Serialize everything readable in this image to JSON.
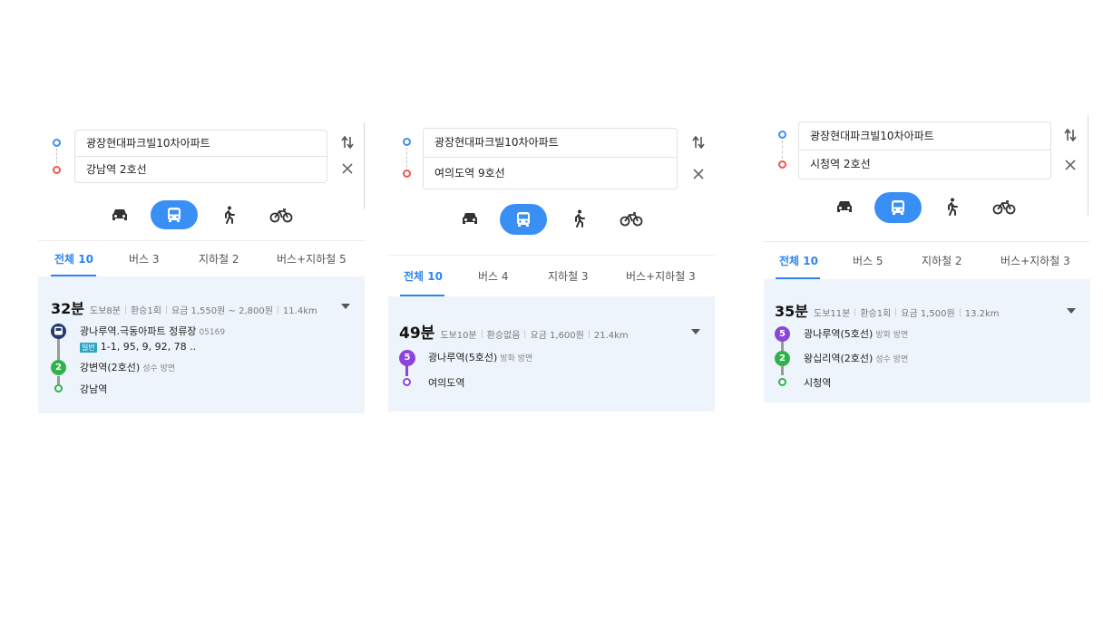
{
  "panels": [
    {
      "origin": "광장현대파크빌10차아파트",
      "destination": "강남역 2호선",
      "tabs": [
        {
          "label": "전체 10",
          "active": true
        },
        {
          "label": "버스 3"
        },
        {
          "label": "지하철 2"
        },
        {
          "label": "버스+지하철 5"
        }
      ],
      "result": {
        "time": "32분",
        "walk": "도보8분",
        "transfer": "환승1회",
        "fare": "요금 1,550원 ~ 2,800원",
        "distance": "11.4km",
        "steps": [
          {
            "badge": "",
            "badge_type": "bus",
            "name": "광나루역.극동아파트 정류장",
            "sub": "05169",
            "bus_tag": "일반",
            "bus_numbers": "1-1, 95, 9, 92, 78 ..",
            "color": "#263a6e"
          },
          {
            "badge": "2",
            "name": "강변역(2호선)",
            "sub": "성수 방면",
            "color": "#2fb24a"
          },
          {
            "badge": "",
            "badge_type": "end",
            "name": "강남역",
            "color": "#2fb24a"
          }
        ]
      }
    },
    {
      "origin": "광장현대파크빌10차아파트",
      "destination": "여의도역 9호선",
      "tabs": [
        {
          "label": "전체 10",
          "active": true
        },
        {
          "label": "버스 4"
        },
        {
          "label": "지하철 3"
        },
        {
          "label": "버스+지하철 3"
        }
      ],
      "result": {
        "time": "49분",
        "walk": "도보10분",
        "transfer": "환승없음",
        "fare": "요금 1,600원",
        "distance": "21.4km",
        "steps": [
          {
            "badge": "5",
            "name": "광나루역(5호선)",
            "sub": "방화 방면",
            "color": "#8c45d8"
          },
          {
            "badge": "",
            "badge_type": "end",
            "name": "여의도역",
            "color": "#8c45d8"
          }
        ]
      }
    },
    {
      "origin": "광장현대파크빌10차아파트",
      "destination": "시청역 2호선",
      "tabs": [
        {
          "label": "전체 10",
          "active": true
        },
        {
          "label": "버스 5"
        },
        {
          "label": "지하철 2"
        },
        {
          "label": "버스+지하철 3"
        }
      ],
      "result": {
        "time": "35분",
        "walk": "도보11분",
        "transfer": "환승1회",
        "fare": "요금 1,500원",
        "distance": "13.2km",
        "steps": [
          {
            "badge": "5",
            "name": "광나루역(5호선)",
            "sub": "방화 방면",
            "color": "#8c45d8"
          },
          {
            "badge": "2",
            "name": "왕십리역(2호선)",
            "sub": "성수 방면",
            "color": "#2fb24a"
          },
          {
            "badge": "",
            "badge_type": "end",
            "name": "시청역",
            "color": "#2fb24a"
          }
        ]
      }
    }
  ],
  "colors": {
    "accent": "#3a8ff5",
    "origin": "#3b8ff5",
    "destination": "#f2554f"
  },
  "icons": {
    "car": "car-icon",
    "bus": "bus-icon",
    "walk": "walk-icon",
    "bike": "bike-icon",
    "swap": "swap-icon",
    "close": "close-icon",
    "expand": "caret-down-icon"
  }
}
